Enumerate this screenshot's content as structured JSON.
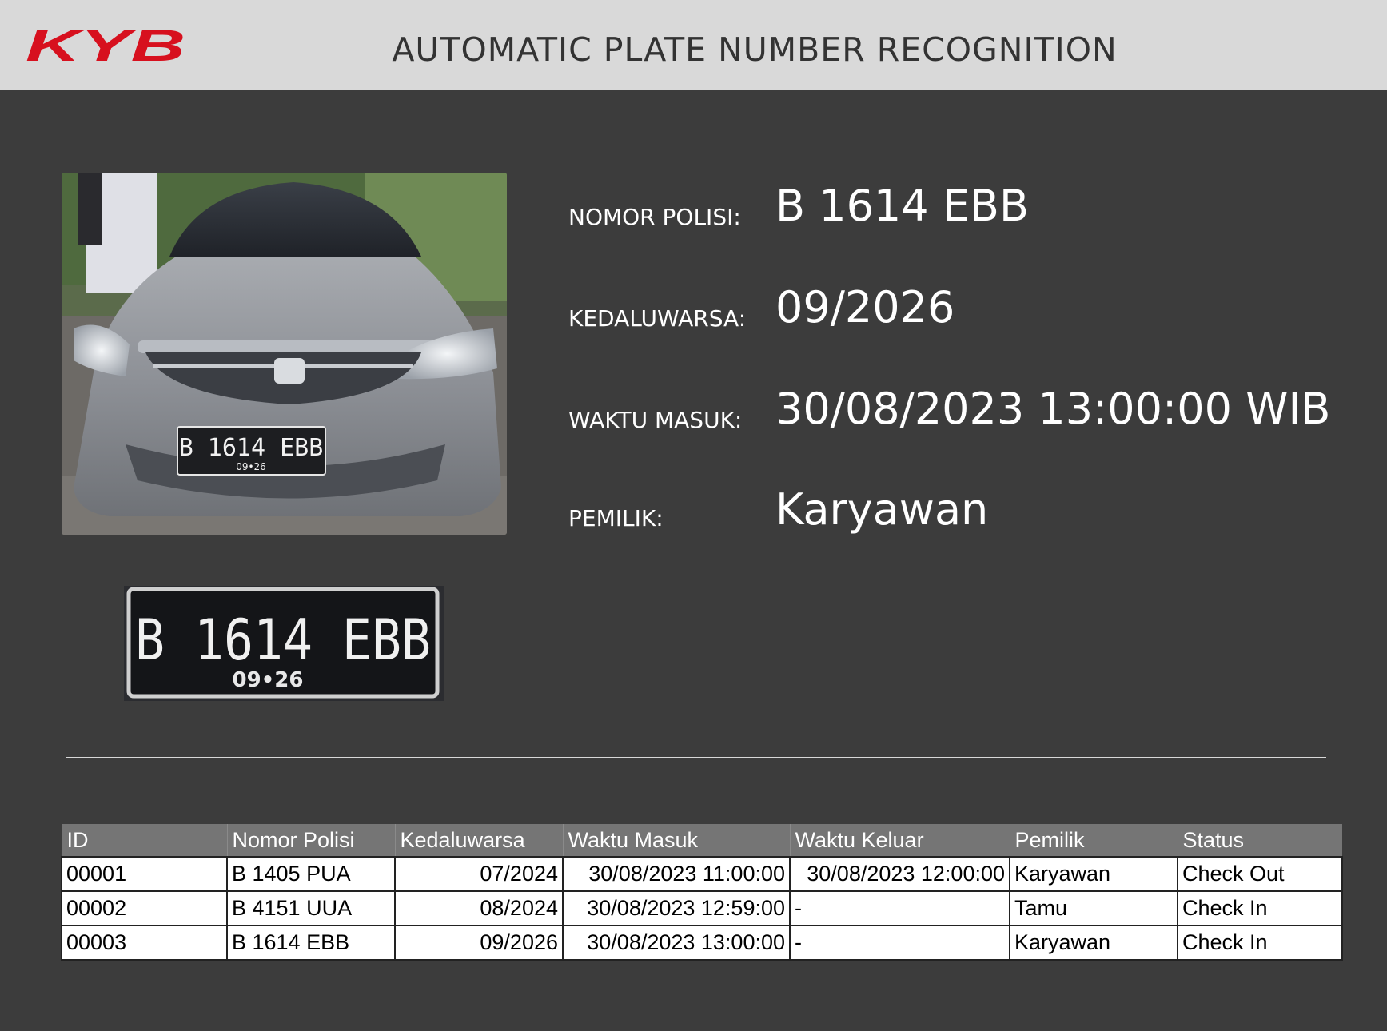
{
  "header": {
    "logo_text": "KYB",
    "title": "AUTOMATIC PLATE NUMBER RECOGNITION"
  },
  "colors": {
    "header_bg": "#d9d9d9",
    "page_bg": "#3c3c3c",
    "logo_red": "#d7101e",
    "table_header_bg": "#757575"
  },
  "detection": {
    "car_photo_icon": "car-front-photo",
    "plate_crop_icon": "license-plate-crop",
    "plate_main": "B 1614 EBB",
    "plate_sub": "09•26",
    "fields": [
      {
        "label": "NOMOR POLISI:",
        "value": "B 1614 EBB"
      },
      {
        "label": "KEDALUWARSA:",
        "value": "09/2026"
      },
      {
        "label": "WAKTU MASUK:",
        "value": "30/08/2023 13:00:00 WIB"
      },
      {
        "label": "PEMILIK:",
        "value": "Karyawan"
      }
    ]
  },
  "table": {
    "columns": [
      "ID",
      "Nomor Polisi",
      "Kedaluwarsa",
      "Waktu Masuk",
      "Waktu Keluar",
      "Pemilik",
      "Status"
    ],
    "rows": [
      [
        "00001",
        "B 1405 PUA",
        "07/2024",
        "30/08/2023 11:00:00",
        "30/08/2023 12:00:00",
        "Karyawan",
        "Check Out"
      ],
      [
        "00002",
        "B 4151 UUA",
        "08/2024",
        "30/08/2023 12:59:00",
        "-",
        "Tamu",
        "Check In"
      ],
      [
        "00003",
        "B 1614 EBB",
        "09/2026",
        "30/08/2023 13:00:00",
        "-",
        "Karyawan",
        "Check In"
      ]
    ]
  }
}
